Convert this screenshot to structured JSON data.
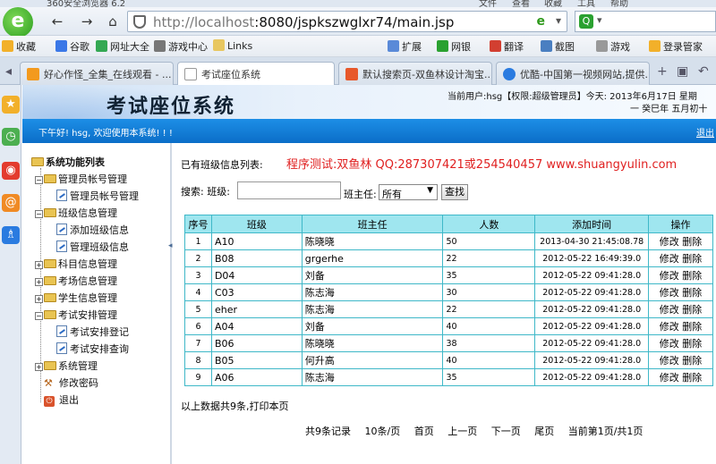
{
  "browser": {
    "title_fragment": "360安全浏览器 6.2",
    "top_menu": [
      "文件",
      "查看",
      "收藏",
      "工具",
      "帮助"
    ],
    "address_url_host": "http://localhost",
    "address_url_rest": ":8080/jspkszwglxr74/main.jsp",
    "favorites": [
      "收藏",
      "谷歌",
      "网址大全",
      "游戏中心",
      "Links",
      "扩展",
      "网银",
      "翻译",
      "截图",
      "游戏",
      "登录管家"
    ],
    "tabs": [
      {
        "label": "好心作怪_全集_在线观看 - ...",
        "active": false
      },
      {
        "label": "考试座位系统",
        "active": true
      },
      {
        "label": "默认搜索页-双鱼林设计淘宝...",
        "active": false
      },
      {
        "label": "优酷-中国第一视频网站,提供...",
        "active": false
      }
    ]
  },
  "header": {
    "system_name": "考试座位系统",
    "user_info": "当前用户:hsg【权限:超级管理员】今天: 2013年6月17日 星期",
    "lunar_date": "一 癸巳年 五月初十",
    "welcome": "下午好! hsg, 欢迎使用本系统! ! !",
    "logout": "退出"
  },
  "menu": {
    "root": "系统功能列表",
    "items": [
      {
        "label": "管理员帐号管理",
        "type": "folder",
        "expanded": true
      },
      {
        "label": "管理员帐号管理",
        "type": "doc"
      },
      {
        "label": "班级信息管理",
        "type": "folder",
        "expanded": true
      },
      {
        "label": "添加班级信息",
        "type": "doc"
      },
      {
        "label": "管理班级信息",
        "type": "doc"
      },
      {
        "label": "科目信息管理",
        "type": "folder",
        "expanded": false
      },
      {
        "label": "考场信息管理",
        "type": "folder",
        "expanded": false
      },
      {
        "label": "学生信息管理",
        "type": "folder",
        "expanded": false
      },
      {
        "label": "考试安排管理",
        "type": "folder",
        "expanded": true
      },
      {
        "label": "考试安排登记",
        "type": "doc"
      },
      {
        "label": "考试安排查询",
        "type": "doc"
      },
      {
        "label": "系统管理",
        "type": "folder",
        "expanded": false
      },
      {
        "label": "修改密码",
        "type": "tool"
      },
      {
        "label": "退出",
        "type": "exit"
      }
    ]
  },
  "content": {
    "list_title": "已有班级信息列表:",
    "contact": "程序测试:双鱼林 QQ:287307421或254540457 www.shuangyulin.com",
    "search_label": "搜索: 班级:",
    "teacher_label": "班主任:",
    "teacher_select": "所有",
    "search_button": "查找",
    "columns": [
      "序号",
      "班级",
      "班主任",
      "人数",
      "添加时间",
      "操作"
    ],
    "rows": [
      {
        "no": "1",
        "cls": "A10",
        "teacher": "陈晓晓",
        "count": "50",
        "time": "2013-04-30 21:45:08.78"
      },
      {
        "no": "2",
        "cls": "B08",
        "teacher": "grgerhe",
        "count": "22",
        "time": "2012-05-22 16:49:39.0"
      },
      {
        "no": "3",
        "cls": "D04",
        "teacher": "刘备",
        "count": "35",
        "time": "2012-05-22 09:41:28.0"
      },
      {
        "no": "4",
        "cls": "C03",
        "teacher": "陈志海",
        "count": "30",
        "time": "2012-05-22 09:41:28.0"
      },
      {
        "no": "5",
        "cls": "eher",
        "teacher": "陈志海",
        "count": "22",
        "time": "2012-05-22 09:41:28.0"
      },
      {
        "no": "6",
        "cls": "A04",
        "teacher": "刘备",
        "count": "40",
        "time": "2012-05-22 09:41:28.0"
      },
      {
        "no": "7",
        "cls": "B06",
        "teacher": "陈晓晓",
        "count": "38",
        "time": "2012-05-22 09:41:28.0"
      },
      {
        "no": "8",
        "cls": "B05",
        "teacher": "何升高",
        "count": "40",
        "time": "2012-05-22 09:41:28.0"
      },
      {
        "no": "9",
        "cls": "A06",
        "teacher": "陈志海",
        "count": "35",
        "time": "2012-05-22 09:41:28.0"
      }
    ],
    "action_edit": "修改",
    "action_delete": "删除",
    "total_line": "以上数据共9条,打印本页",
    "pager": [
      "共9条记录",
      "10条/页",
      "首页",
      "上一页",
      "下一页",
      "尾页",
      "当前第1页/共1页"
    ]
  },
  "colors": {
    "welcome_bar": "#0b6ec8",
    "table_header": "#9fe6ef",
    "table_border": "#3fb8c8",
    "contact_red": "#e02020"
  }
}
